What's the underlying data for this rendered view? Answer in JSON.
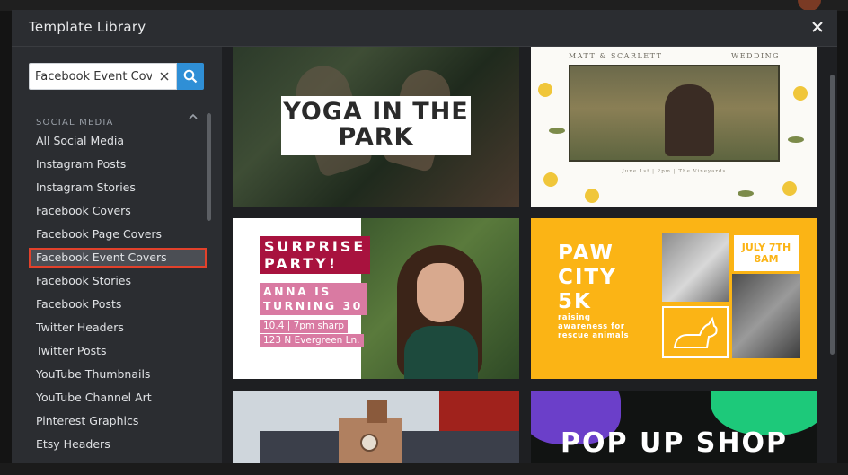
{
  "modal": {
    "title": "Template Library"
  },
  "search": {
    "value": "Facebook Event Covers",
    "placeholder": "Search"
  },
  "sidebar": {
    "section_label": "SOCIAL MEDIA",
    "items": [
      {
        "label": "All Social Media"
      },
      {
        "label": "Instagram Posts"
      },
      {
        "label": "Instagram Stories"
      },
      {
        "label": "Facebook Covers"
      },
      {
        "label": "Facebook Page Covers"
      },
      {
        "label": "Facebook Event Covers",
        "selected": true
      },
      {
        "label": "Facebook Stories"
      },
      {
        "label": "Facebook Posts"
      },
      {
        "label": "Twitter Headers"
      },
      {
        "label": "Twitter Posts"
      },
      {
        "label": "YouTube Thumbnails"
      },
      {
        "label": "YouTube Channel Art"
      },
      {
        "label": "Pinterest Graphics"
      },
      {
        "label": "Etsy Headers"
      }
    ]
  },
  "templates": {
    "yoga": {
      "title": "YOGA IN THE PARK"
    },
    "wedding": {
      "names": "MATT & SCARLETT",
      "word": "WEDDING",
      "details": "June 1st | 2pm | The Vineyards"
    },
    "party": {
      "title": "SURPRISE\nPARTY!",
      "sub": "ANNA IS\nTURNING 30",
      "line1": "10.4 | 7pm sharp",
      "line2": "123 N Evergreen Ln."
    },
    "paw": {
      "title": "PAW\nCITY\n5K",
      "sub": "raising\nawareness for\nrescue animals",
      "date": "JULY 7TH\n8AM"
    },
    "popup": {
      "title": "POP UP SHOP"
    }
  },
  "colors": {
    "accent": "#2f8fd6",
    "selection_border": "#e2412b",
    "party_magenta": "#a8123e",
    "party_pink": "#d97aa2",
    "paw_yellow": "#fbb415"
  },
  "icons": {
    "close": "close-icon",
    "clear": "clear-icon",
    "search": "search-icon",
    "collapse": "chevron-up-icon"
  }
}
